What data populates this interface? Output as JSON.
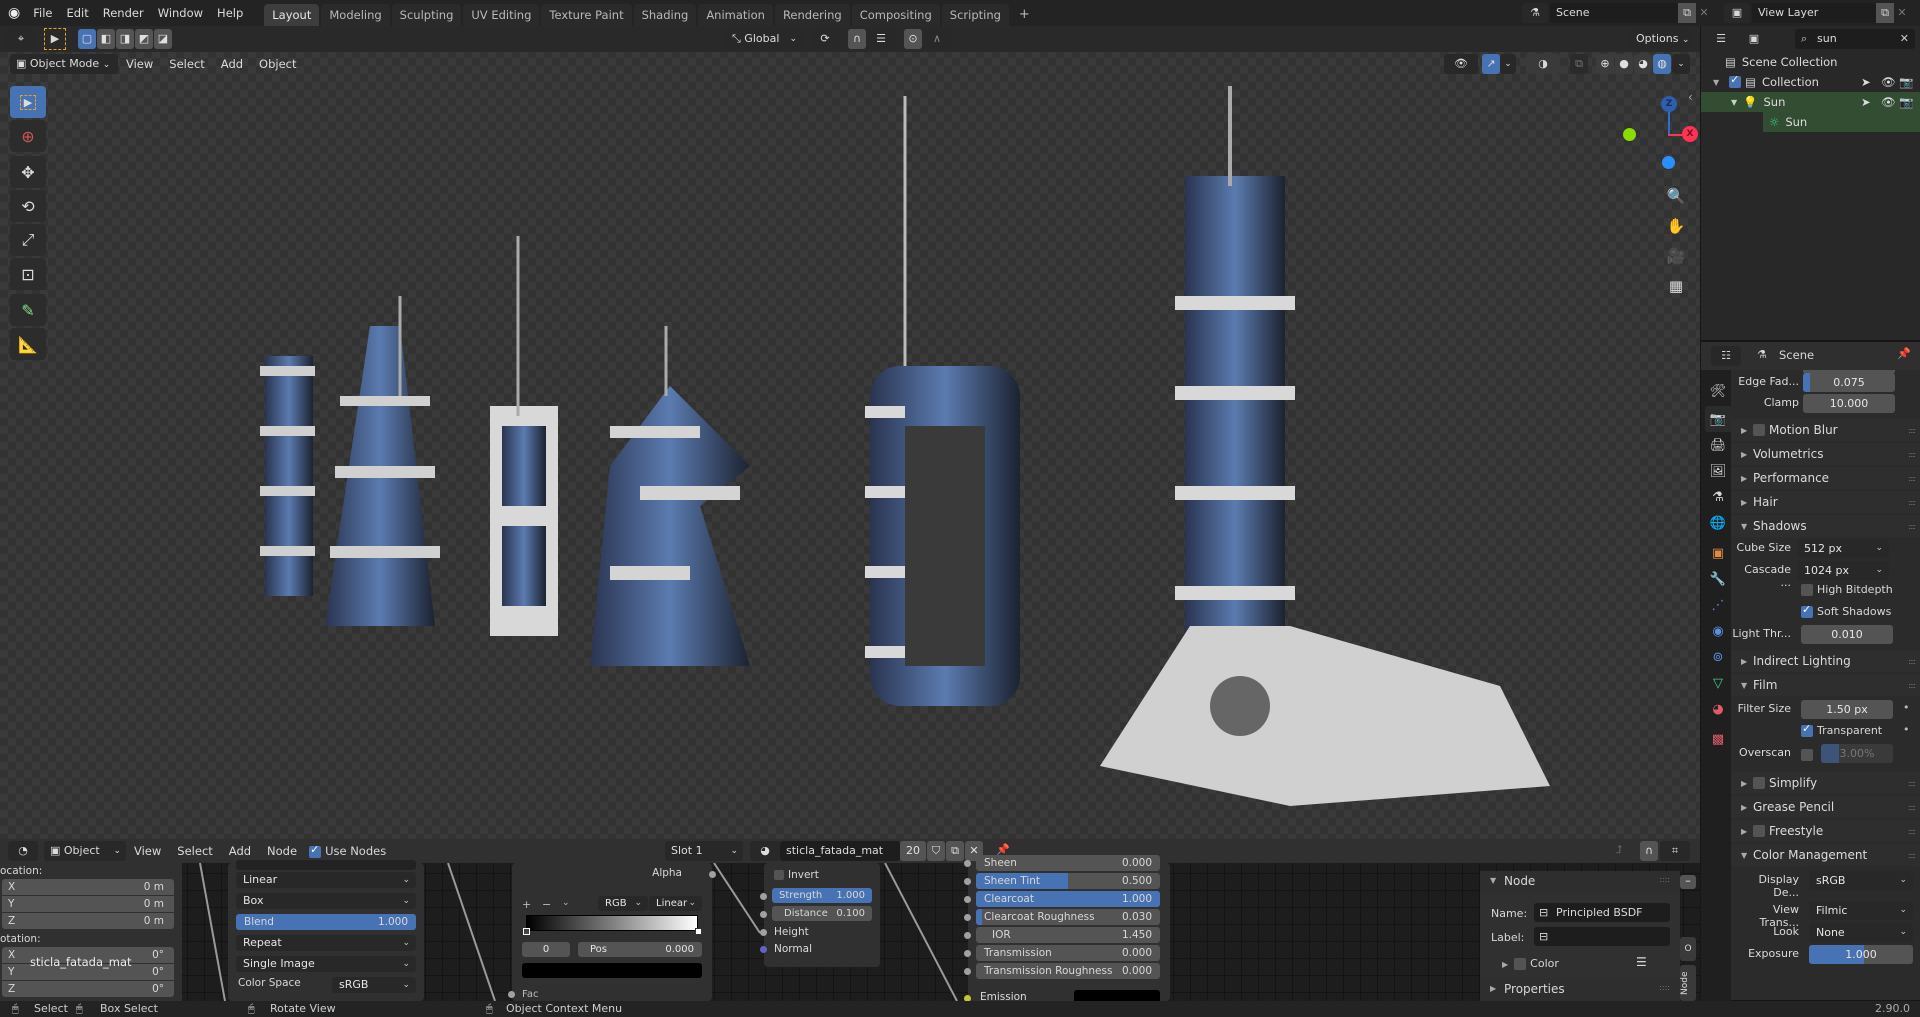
{
  "topbar": {
    "menus": [
      "File",
      "Edit",
      "Render",
      "Window",
      "Help"
    ],
    "workspaces": [
      "Layout",
      "Modeling",
      "Sculpting",
      "UV Editing",
      "Texture Paint",
      "Shading",
      "Animation",
      "Rendering",
      "Compositing",
      "Scripting"
    ],
    "active_workspace": "Layout",
    "add_workspace": "+",
    "scene_label": "Scene",
    "view_layer_label": "View Layer"
  },
  "viewport": {
    "mode": "Object Mode",
    "menus": [
      "View",
      "Select",
      "Add",
      "Object"
    ],
    "transform_orientation": "Global",
    "options_label": "Options",
    "tools": [
      "select-box-icon",
      "cursor-icon",
      "move-icon",
      "rotate-icon",
      "scale-icon",
      "transform-icon",
      "annotate-icon",
      "measure-icon"
    ],
    "gizmo": {
      "z": "Z",
      "x": "X"
    }
  },
  "outliner": {
    "search_value": "sun",
    "rows": [
      {
        "label": "Scene Collection",
        "icon": "collection-icon"
      },
      {
        "label": "Collection",
        "icon": "collection-icon"
      },
      {
        "label": "Sun",
        "icon": "light-object-icon"
      },
      {
        "label": "Sun",
        "icon": "sun-light-data-icon"
      }
    ]
  },
  "properties": {
    "context": "Scene",
    "edge_fade": {
      "label": "Edge Fad...",
      "value": "0.075",
      "fraction": 0.075
    },
    "clamp": {
      "label": "Clamp",
      "value": "10.000"
    },
    "panels": {
      "motion_blur": "Motion Blur",
      "volumetrics": "Volumetrics",
      "performance": "Performance",
      "hair": "Hair",
      "shadows": "Shadows",
      "indirect_lighting": "Indirect Lighting",
      "film": "Film",
      "simplify": "Simplify",
      "grease_pencil": "Grease Pencil",
      "freestyle": "Freestyle",
      "color_management": "Color Management"
    },
    "shadows": {
      "cube_size_label": "Cube Size",
      "cube_size": "512 px",
      "cascade_label": "Cascade ...",
      "cascade": "1024 px",
      "high_bitdepth": "High Bitdepth",
      "high_bitdepth_checked": false,
      "soft_shadows": "Soft Shadows",
      "soft_shadows_checked": true,
      "light_threshold_label": "Light Thr...",
      "light_threshold": "0.010"
    },
    "film": {
      "filter_size_label": "Filter Size",
      "filter_size": "1.50 px",
      "transparent": "Transparent",
      "transparent_checked": true,
      "overscan_label": "Overscan",
      "overscan": "3.00%",
      "overscan_fraction": 0.03
    },
    "color_management": {
      "display_label": "Display De...",
      "display": "sRGB",
      "view_label": "View Trans...",
      "view": "Filmic",
      "look_label": "Look",
      "look": "None",
      "exposure_label": "Exposure",
      "exposure": "1.000"
    }
  },
  "node_editor": {
    "type": "Object",
    "menus": [
      "View",
      "Select",
      "Add",
      "Node"
    ],
    "use_nodes": "Use Nodes",
    "slot": "Slot 1",
    "material": "sticla_fatada_mat",
    "users": "20",
    "sidebar": {
      "location_label": "ocation:",
      "rotation_label": "otation:",
      "loc": [
        {
          "axis": "X",
          "value": "0 m"
        },
        {
          "axis": "Y",
          "value": "0 m"
        },
        {
          "axis": "Z",
          "value": "0 m"
        }
      ],
      "rot": [
        {
          "axis": "X",
          "value": "0°"
        },
        {
          "axis": "Y",
          "value": "0°"
        },
        {
          "axis": "Z",
          "value": "0°"
        }
      ],
      "tooltip": "sticla_fatada_mat"
    },
    "image_node": {
      "interpolation": "Linear",
      "projection": "Box",
      "blend_label": "Blend",
      "blend": "1.000",
      "extension": "Repeat",
      "source": "Single Image",
      "color_space_label": "Color Space",
      "color_space": "sRGB"
    },
    "colorramp_node": {
      "alpha": "Alpha",
      "color_mode": "RGB",
      "interp": "Linear",
      "index": "0",
      "pos_label": "Pos",
      "pos": "0.000",
      "fac": "Fac"
    },
    "bump_node": {
      "invert": "Invert",
      "strength_label": "Strength",
      "strength": "1.000",
      "distance_label": "Distance",
      "distance": "0.100",
      "height": "Height",
      "normal": "Normal"
    },
    "bsdf_node": {
      "rows": [
        {
          "label": "Sheen",
          "value": "0.000",
          "fraction": 0
        },
        {
          "label": "Sheen Tint",
          "value": "0.500",
          "fraction": 0.5
        },
        {
          "label": "Clearcoat",
          "value": "1.000",
          "fraction": 1
        },
        {
          "label": "Clearcoat Roughness",
          "value": "0.030",
          "fraction": 0.03
        },
        {
          "label": "IOR",
          "value": "1.450",
          "fraction": 0
        },
        {
          "label": "Transmission",
          "value": "0.000",
          "fraction": 0
        },
        {
          "label": "Transmission Roughness",
          "value": "0.000",
          "fraction": 0
        }
      ],
      "emission": "Emission"
    },
    "node_panel": {
      "title": "Node",
      "name_label": "Name:",
      "name": "Principled BSDF",
      "label_label": "Label:",
      "label": "",
      "color": "Color",
      "properties": "Properties",
      "tab": "Node"
    }
  },
  "statusbar": {
    "select": "Select",
    "box_select": "Box Select",
    "rotate_view": "Rotate View",
    "context_menu": "Object Context Menu",
    "version": "2.90.0"
  },
  "colors": {
    "accent": "#4772b3",
    "selected_row": "#334d33",
    "x_axis": "#ff3352",
    "y_axis": "#8bdc00",
    "z_axis": "#2c8fff"
  }
}
